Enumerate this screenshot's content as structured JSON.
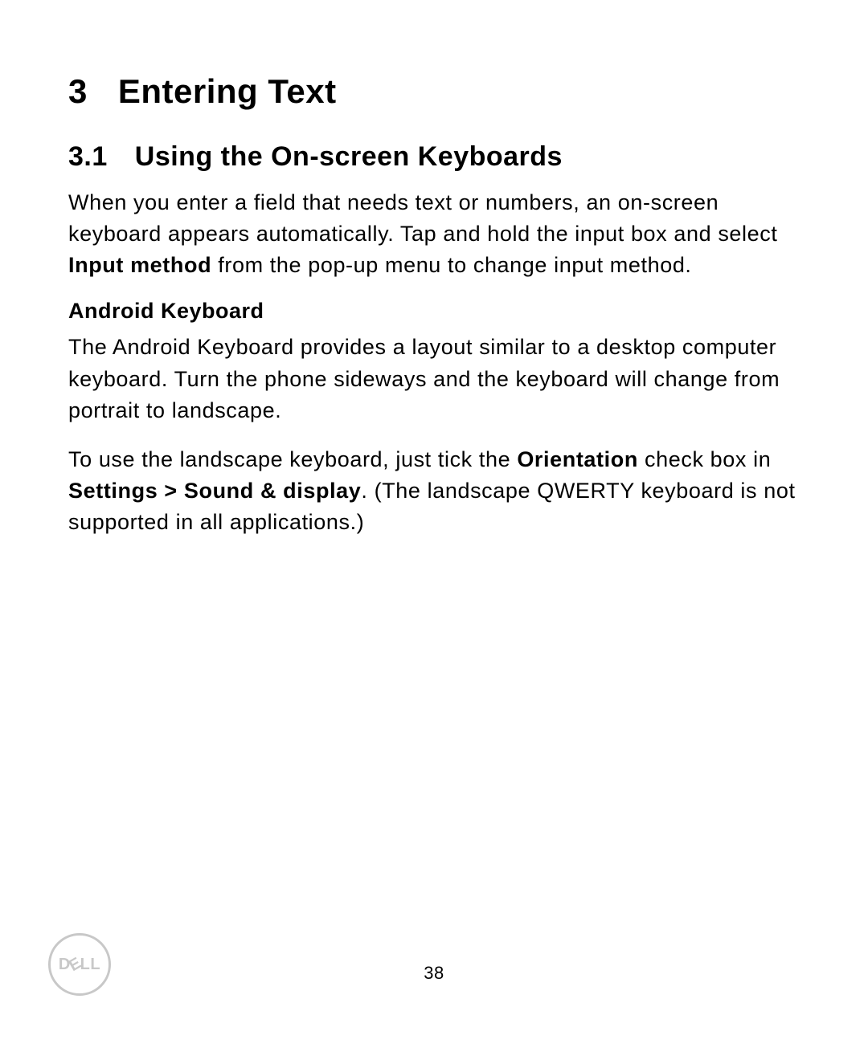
{
  "chapter": {
    "number": "3",
    "title": "Entering Text"
  },
  "section": {
    "number": "3.1",
    "title": "Using the On-screen Keyboards"
  },
  "intro_para": {
    "part1": "When you enter a field that needs text or numbers, an on-screen keyboard appears automatically. Tap and hold the input box and select ",
    "bold1": "Input method",
    "part2": " from the pop-up menu to change input method."
  },
  "sub_heading": "Android Keyboard",
  "para2": "The Android Keyboard provides a layout similar to a desktop computer keyboard. Turn the phone sideways and the keyboard will change from portrait to landscape.",
  "para3": {
    "part1": "To use the landscape keyboard, just tick the ",
    "bold1": "Orientation",
    "part2": " check box in ",
    "bold2": "Settings > Sound & display",
    "part3": ". (The landscape QWERTY keyboard is not supported in all applications.)"
  },
  "footer": {
    "page_number": "38",
    "logo_letters": {
      "d": "D",
      "e": "E",
      "l1": "L",
      "l2": "L"
    }
  }
}
